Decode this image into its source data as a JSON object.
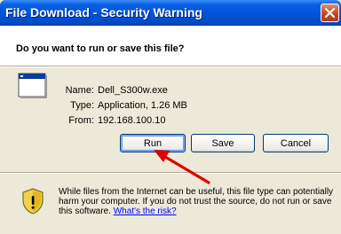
{
  "window": {
    "title": "File Download - Security Warning"
  },
  "header": {
    "question": "Do you want to run or save this file?"
  },
  "file": {
    "name_label": "Name:",
    "name_value": "Dell_S300w.exe",
    "type_label": "Type:",
    "type_value": "Application, 1.26 MB",
    "from_label": "From:",
    "from_value": "192.168.100.10",
    "icon": "application-window-icon"
  },
  "buttons": {
    "run": "Run",
    "save": "Save",
    "cancel": "Cancel"
  },
  "warning": {
    "text": "While files from the Internet can be useful, this file type can potentially harm your computer. If you do not trust the source, do not run or save this software.",
    "link": "What's the risk?",
    "icon": "security-shield-icon"
  },
  "colors": {
    "titlebar": "#0053d9",
    "dialog": "#ece9d8",
    "close": "#c9411f",
    "annotation_arrow": "#e00000",
    "link": "#0000ff"
  }
}
